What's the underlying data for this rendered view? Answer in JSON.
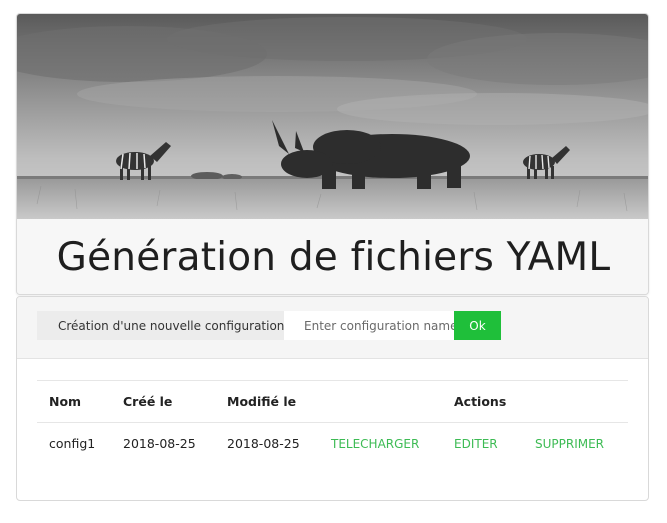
{
  "hero": {
    "title": "Génération de fichiers YAML",
    "image_subject": "rhino-zebra-savanna-photo"
  },
  "create_form": {
    "label": "Création d'une nouvelle configuration",
    "input_placeholder": "Enter configuration name",
    "input_value": "",
    "ok_label": "Ok"
  },
  "table": {
    "headers": {
      "nom": "Nom",
      "cree": "Créé le",
      "modifie": "Modifié le",
      "empty": "",
      "actions": "Actions"
    },
    "rows": [
      {
        "nom": "config1",
        "cree": "2018-08-25",
        "modifie": "2018-08-25",
        "download": "TELECHARGER",
        "edit": "EDITER",
        "delete": "SUPPRIMER"
      }
    ]
  },
  "colors": {
    "accent_green": "#1fbf3a",
    "link_green": "#3dbb54"
  }
}
